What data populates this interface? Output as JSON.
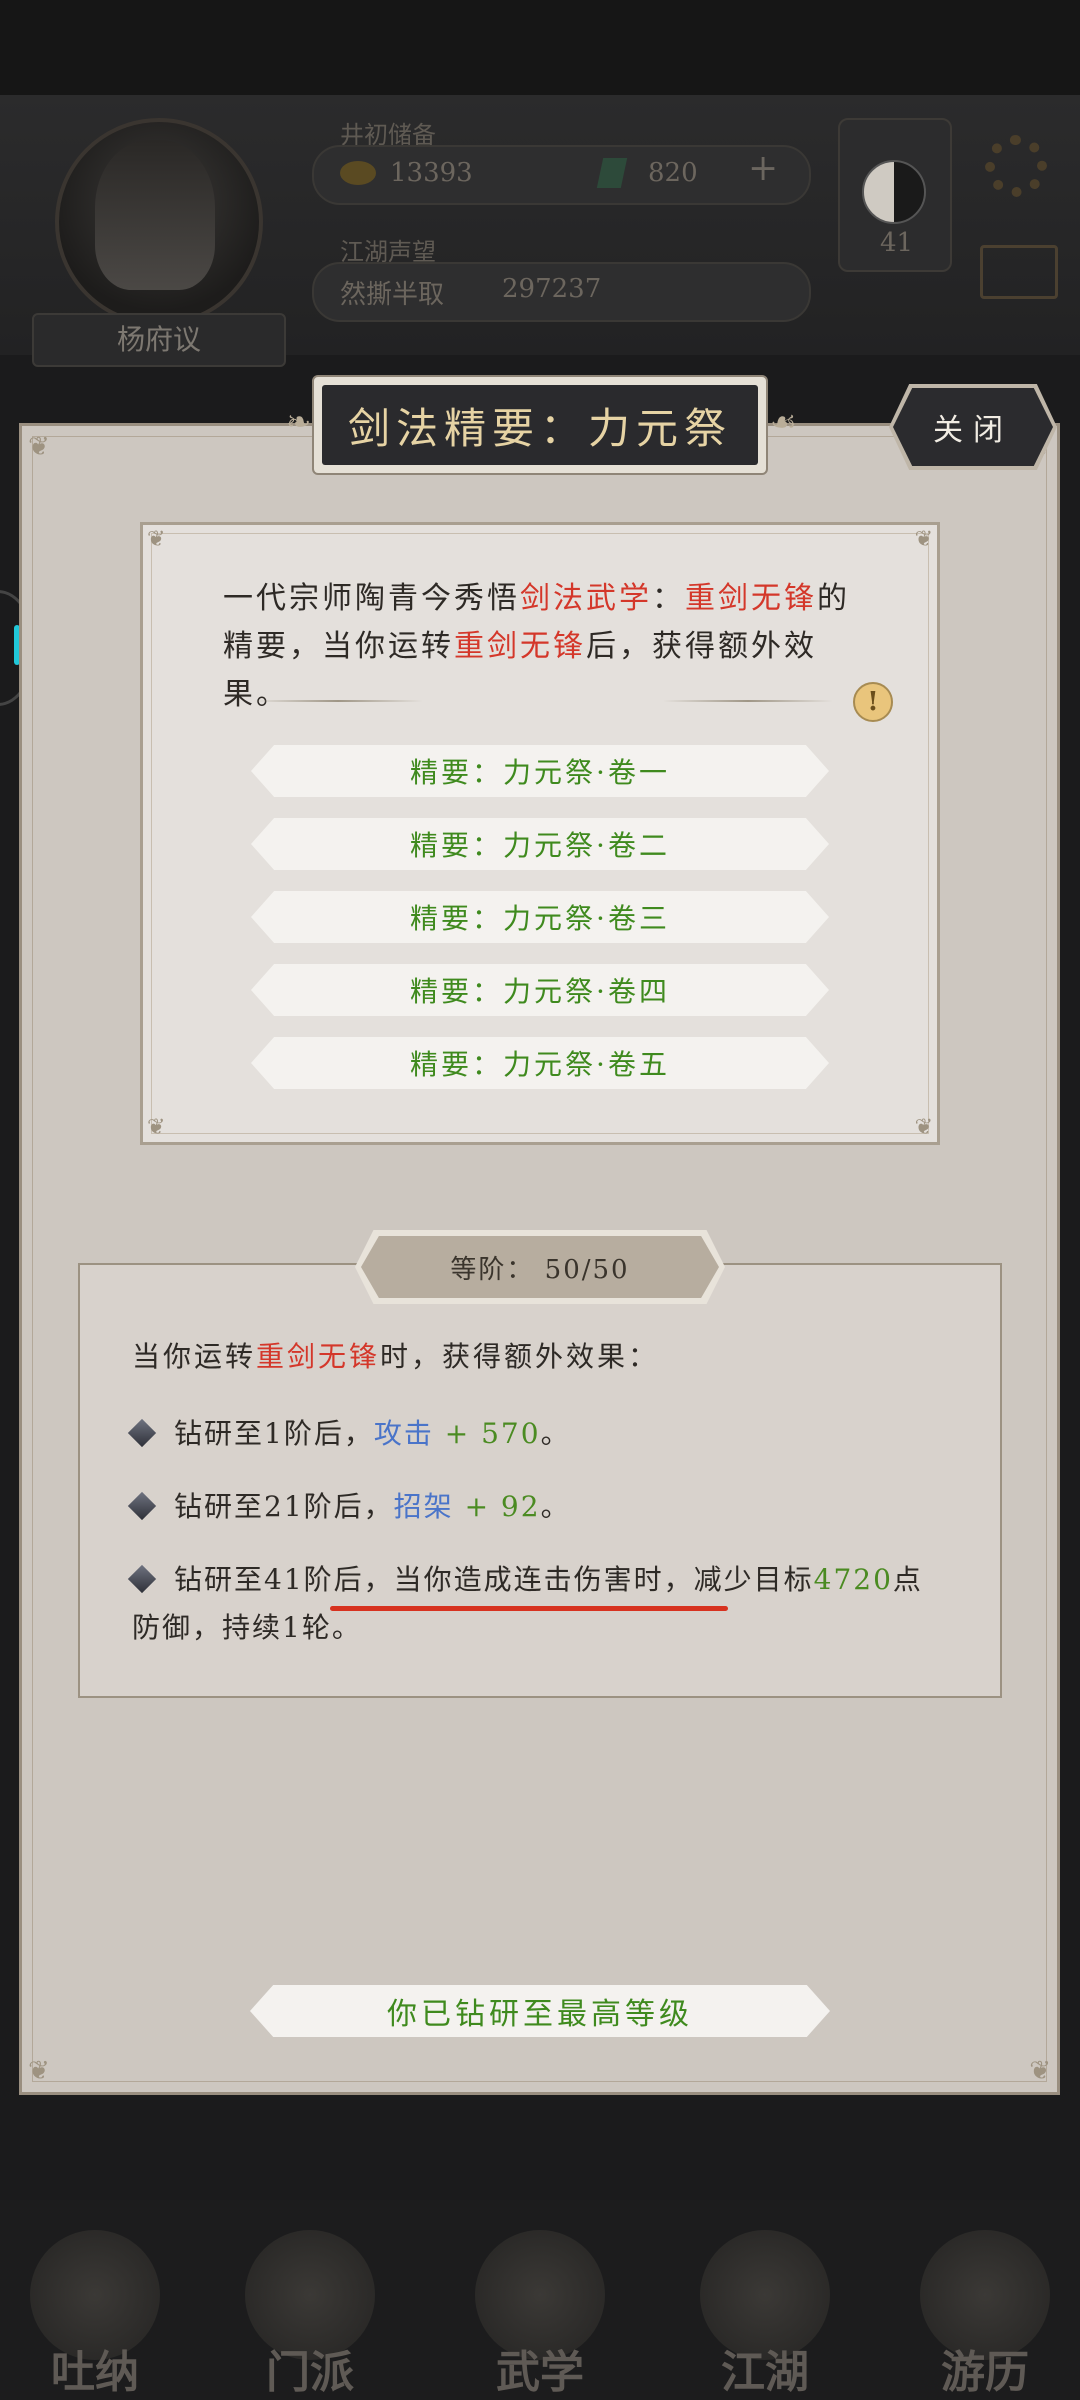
{
  "hud": {
    "player_name": "杨府议",
    "row1_label": "井初储备",
    "coins": "13393",
    "gems": "820",
    "row2_label": "江湖声望",
    "reputation_label": "然撕半取",
    "reputation_value": "297237",
    "level_badge": "41"
  },
  "dialog": {
    "title": "剑法精要：力元祭",
    "close_label": "关闭",
    "description": {
      "part1": "一代宗师陶青今秀悟",
      "highlight1": "剑法武学",
      "part2": "：",
      "highlight2": "重剑无锋",
      "part3": "的精要，当你运转",
      "highlight3": "重剑无锋",
      "part4": "后，获得额外效果。"
    },
    "info_icon": "!",
    "chapters": [
      "精要：力元祭·卷一",
      "精要：力元祭·卷二",
      "精要：力元祭·卷三",
      "精要：力元祭·卷四",
      "精要：力元祭·卷五"
    ],
    "level_tab": "等阶：  50/50",
    "effect_intro": {
      "part1": "当你运转",
      "highlight": "重剑无锋",
      "part2": "时，获得额外效果："
    },
    "effects": [
      {
        "prefix": "钻研至1阶后，",
        "stat": "攻击",
        "value": "+ 570",
        "suffix": "。"
      },
      {
        "prefix": "钻研至21阶后，",
        "stat": "招架",
        "value": "+ 92",
        "suffix": "。"
      },
      {
        "prefix": "钻研至41阶后，当你造成连击伤害时，减少目标",
        "value": "4720",
        "suffix": "点防御，持续1轮。"
      }
    ],
    "max_label": "你已钻研至最高等级"
  },
  "bottom_nav": [
    "吐纳",
    "门派",
    "武学",
    "江湖",
    "游历"
  ],
  "colors": {
    "highlight_red": "#d4372a",
    "stat_blue": "#4a74c9",
    "value_green": "#4b8b22",
    "annotation_red": "#d7321f"
  }
}
